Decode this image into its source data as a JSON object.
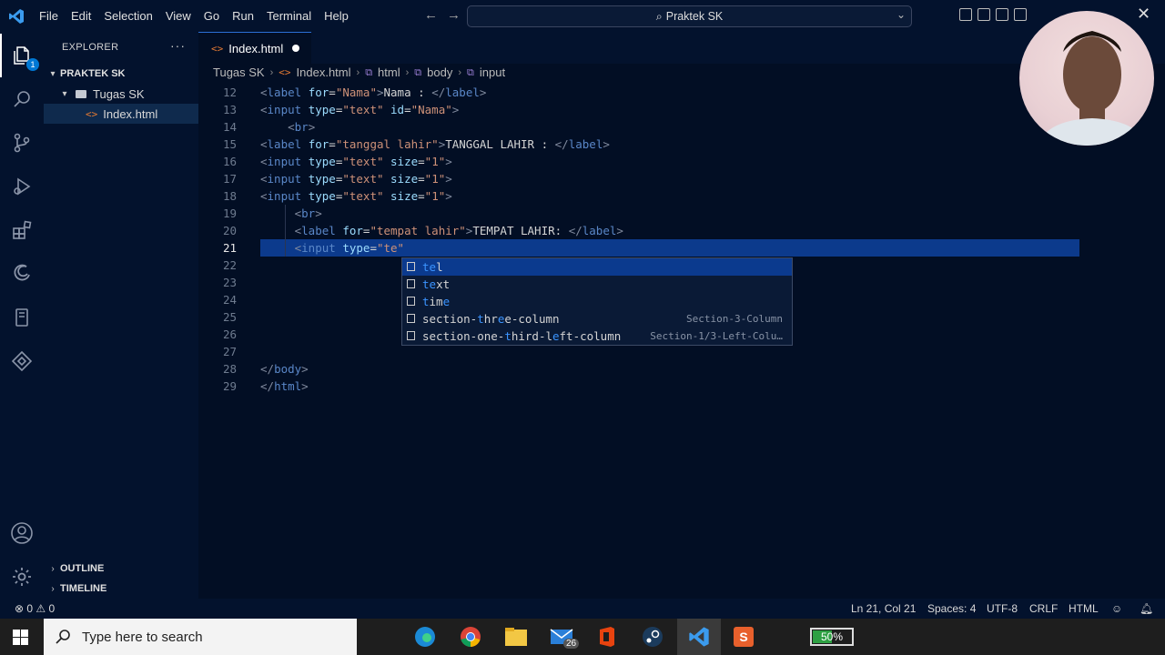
{
  "titlebar": {
    "menu": [
      "File",
      "Edit",
      "Selection",
      "View",
      "Go",
      "Run",
      "Terminal",
      "Help"
    ],
    "command_center": "Praktek SK"
  },
  "activity": {
    "explorer_badge": "1"
  },
  "sidebar": {
    "title": "EXPLORER",
    "more": "···",
    "project": "PRAKTEK SK",
    "folder": "Tugas SK",
    "file": "Index.html",
    "outline": "OUTLINE",
    "timeline": "TIMELINE"
  },
  "tab": {
    "label": "Index.html",
    "icon": "<>"
  },
  "breadcrumb": [
    "Tugas SK",
    "Index.html",
    "html",
    "body",
    "input"
  ],
  "editor": {
    "current_line": 21,
    "lines": [
      {
        "n": "12",
        "tokens": [
          [
            "<",
            "br"
          ],
          [
            "label",
            "tag"
          ],
          [
            " for",
            "attr"
          ],
          [
            "=",
            "txt"
          ],
          [
            "\"Nama\"",
            "str"
          ],
          [
            ">",
            "br"
          ],
          [
            "Nama : ",
            "txt"
          ],
          [
            "</",
            "br"
          ],
          [
            "label",
            "tag"
          ],
          [
            ">",
            "br"
          ]
        ]
      },
      {
        "n": "13",
        "tokens": [
          [
            "<",
            "br"
          ],
          [
            "input",
            "tag"
          ],
          [
            " type",
            "attr"
          ],
          [
            "=",
            "txt"
          ],
          [
            "\"text\"",
            "str"
          ],
          [
            " id",
            "attr"
          ],
          [
            "=",
            "txt"
          ],
          [
            "\"Nama\"",
            "str"
          ],
          [
            ">",
            "br"
          ]
        ]
      },
      {
        "n": "14",
        "tokens": [
          [
            "    <",
            "br"
          ],
          [
            "br",
            "tag"
          ],
          [
            ">",
            "br"
          ]
        ]
      },
      {
        "n": "15",
        "tokens": [
          [
            "<",
            "br"
          ],
          [
            "label",
            "tag"
          ],
          [
            " for",
            "attr"
          ],
          [
            "=",
            "txt"
          ],
          [
            "\"tanggal lahir\"",
            "str"
          ],
          [
            ">",
            "br"
          ],
          [
            "TANGGAL LAHIR : ",
            "txt"
          ],
          [
            "</",
            "br"
          ],
          [
            "label",
            "tag"
          ],
          [
            ">",
            "br"
          ]
        ]
      },
      {
        "n": "16",
        "tokens": [
          [
            "<",
            "br"
          ],
          [
            "input",
            "tag"
          ],
          [
            " type",
            "attr"
          ],
          [
            "=",
            "txt"
          ],
          [
            "\"text\"",
            "str"
          ],
          [
            " size",
            "attr"
          ],
          [
            "=",
            "txt"
          ],
          [
            "\"1\"",
            "str"
          ],
          [
            ">",
            "br"
          ]
        ]
      },
      {
        "n": "17",
        "tokens": [
          [
            "<",
            "br"
          ],
          [
            "input",
            "tag"
          ],
          [
            " type",
            "attr"
          ],
          [
            "=",
            "txt"
          ],
          [
            "\"text\"",
            "str"
          ],
          [
            " size",
            "attr"
          ],
          [
            "=",
            "txt"
          ],
          [
            "\"1\"",
            "str"
          ],
          [
            ">",
            "br"
          ]
        ]
      },
      {
        "n": "18",
        "tokens": [
          [
            "<",
            "br"
          ],
          [
            "input",
            "tag"
          ],
          [
            " type",
            "attr"
          ],
          [
            "=",
            "txt"
          ],
          [
            "\"text\"",
            "str"
          ],
          [
            " size",
            "attr"
          ],
          [
            "=",
            "txt"
          ],
          [
            "\"1\"",
            "str"
          ],
          [
            ">",
            "br"
          ]
        ]
      },
      {
        "n": "19",
        "tokens": [
          [
            "     <",
            "br"
          ],
          [
            "br",
            "tag"
          ],
          [
            ">",
            "br"
          ]
        ]
      },
      {
        "n": "20",
        "tokens": [
          [
            "     <",
            "br"
          ],
          [
            "label",
            "tag"
          ],
          [
            " for",
            "attr"
          ],
          [
            "=",
            "txt"
          ],
          [
            "\"tempat lahir\"",
            "str"
          ],
          [
            ">",
            "br"
          ],
          [
            "TEMPAT LAHIR: ",
            "txt"
          ],
          [
            "</",
            "br"
          ],
          [
            "label",
            "tag"
          ],
          [
            ">",
            "br"
          ]
        ]
      },
      {
        "n": "21",
        "tokens": [
          [
            "     <",
            "br"
          ],
          [
            "input",
            "tag"
          ],
          [
            " type",
            "attr"
          ],
          [
            "=",
            "txt"
          ],
          [
            "\"te\"",
            "str"
          ]
        ]
      },
      {
        "n": "22",
        "tokens": []
      },
      {
        "n": "23",
        "tokens": []
      },
      {
        "n": "24",
        "tokens": []
      },
      {
        "n": "25",
        "tokens": []
      },
      {
        "n": "26",
        "tokens": []
      },
      {
        "n": "27",
        "tokens": []
      },
      {
        "n": "28",
        "tokens": [
          [
            "</",
            "br"
          ],
          [
            "body",
            "tag"
          ],
          [
            ">",
            "br"
          ]
        ]
      },
      {
        "n": "29",
        "tokens": [
          [
            "</",
            "br"
          ],
          [
            "html",
            "tag"
          ],
          [
            ">",
            "br"
          ]
        ]
      }
    ]
  },
  "suggestions": [
    {
      "parts": [
        [
          "te",
          "m"
        ],
        [
          "l",
          ""
        ]
      ],
      "detail": "",
      "selected": true
    },
    {
      "parts": [
        [
          "te",
          "m"
        ],
        [
          "xt",
          ""
        ]
      ],
      "detail": "",
      "selected": false
    },
    {
      "parts": [
        [
          "t",
          "m"
        ],
        [
          "im",
          ""
        ],
        [
          "e",
          "m"
        ]
      ],
      "detail": "",
      "selected": false
    },
    {
      "parts": [
        [
          "section-",
          ""
        ],
        [
          "t",
          "m"
        ],
        [
          "hr",
          ""
        ],
        [
          "e",
          "m"
        ],
        [
          "e-column",
          ""
        ]
      ],
      "detail": "Section-3-Column",
      "selected": false
    },
    {
      "parts": [
        [
          "section-one-",
          ""
        ],
        [
          "t",
          "m"
        ],
        [
          "hird-l",
          ""
        ],
        [
          "e",
          "m"
        ],
        [
          "ft-column",
          ""
        ]
      ],
      "detail": "Section-1/3-Left-Colu…",
      "selected": false
    }
  ],
  "statusbar": {
    "problems": "⊗ 0 ⚠ 0",
    "position": "Ln 21, Col 21",
    "spaces": "Spaces: 4",
    "encoding": "UTF-8",
    "eol": "CRLF",
    "language": "HTML"
  },
  "taskbar": {
    "search_placeholder": "Type here to search",
    "mail_badge": "26",
    "battery": "50%",
    "battery_level": 0.5
  },
  "colors": {
    "accent": "#0078d4",
    "selection": "#0c3a8c",
    "editor_bg": "#020e24"
  }
}
